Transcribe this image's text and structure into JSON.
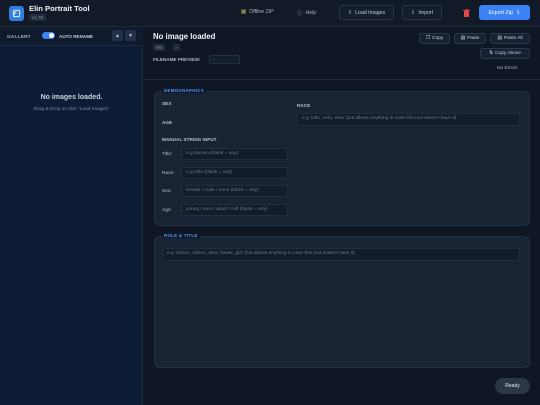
{
  "app": {
    "title": "Elin Portrait Tool",
    "version": "v1.78"
  },
  "toolbar": {
    "offline_zip": "Offline ZIP",
    "help": "Help",
    "load_images": "Load Images",
    "import": "Import",
    "export_zip": "Export Zip"
  },
  "sidebar": {
    "gallery_label": "GALLERY",
    "auto_rename_label": "AUTO RENAME",
    "auto_rename_on": true,
    "empty_title": "No images loaded.",
    "empty_hint": "Drag & Drop or click \"Load Images\""
  },
  "main": {
    "title": "No image loaded",
    "counter": "0/0",
    "dash": "-",
    "filename_preview_label": "FILENAME PREVIEW:",
    "filename_preview_value": "-",
    "actions": {
      "copy": "Copy",
      "paste": "Paste",
      "paste_all": "Paste All",
      "copy_above": "Copy Above"
    },
    "status": "No Errors"
  },
  "demographics": {
    "legend": "DEMOGRAPHICS",
    "sex_label": "SEX",
    "age_label": "AGE",
    "race_label": "RACE",
    "race_placeholder": "e.g 'mifu, nefu, elea' (but allows anything in case this tool doesn't have it)",
    "manual_label": "MANUAL STRING INPUT",
    "manual": [
      {
        "label": "Title:",
        "placeholder": "e.g baroen (blank = any)"
      },
      {
        "label": "Race:",
        "placeholder": "e.g mifu (blank = any)"
      },
      {
        "label": "Sex:",
        "placeholder": "female / male / none (blank = any)"
      },
      {
        "label": "Age:",
        "placeholder": "young / teen / adult / milf (blank = any)"
      }
    ]
  },
  "role": {
    "legend": "ROLE & TITLE",
    "placeholder": "e.g 'citizen, citizen_elea, flower_girl' (but allows anything in case this tool doesn't have it)"
  },
  "status_pill": "Ready",
  "colors": {
    "accent": "#3b82f6",
    "legend": "#4f9bff",
    "trash": "#e5484d"
  }
}
